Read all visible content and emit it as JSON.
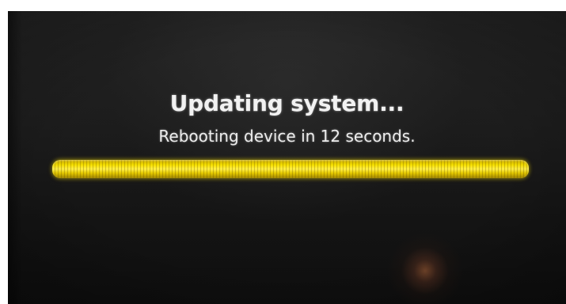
{
  "screen": {
    "title": "Updating system...",
    "subtitle": "Rebooting device in 12 seconds.",
    "progress_percent": 100,
    "colors": {
      "background": "#1f1f1f",
      "text": "#f2f2f2",
      "progress": "#f2d600"
    }
  }
}
